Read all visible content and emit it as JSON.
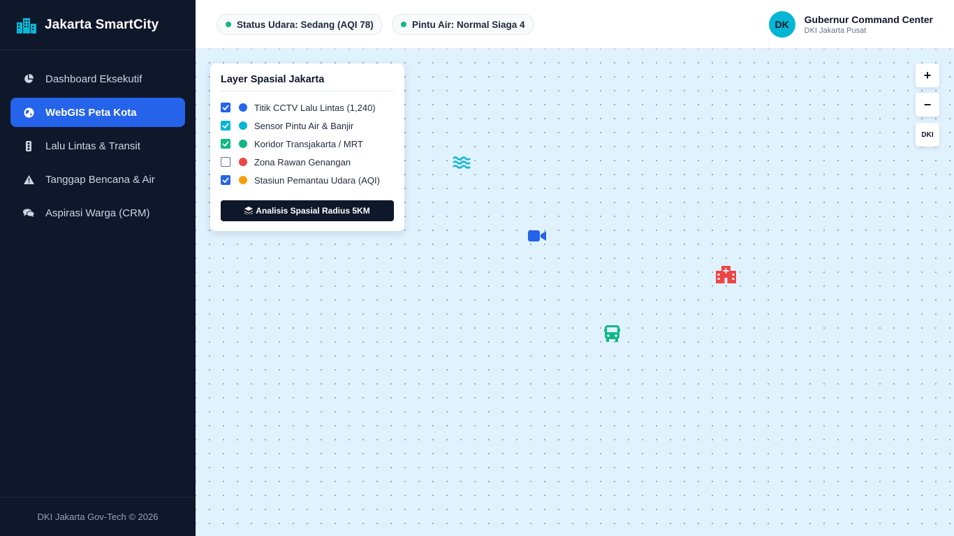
{
  "brand": {
    "title": "Jakarta SmartCity",
    "icon": "city-buildings-icon",
    "color": "#06b6d4"
  },
  "sidebar": {
    "items": [
      {
        "label": "Dashboard Eksekutif",
        "icon": "pie-chart-icon",
        "active": false
      },
      {
        "label": "WebGIS Peta Kota",
        "icon": "globe-icon",
        "active": true
      },
      {
        "label": "Lalu Lintas & Transit",
        "icon": "traffic-light-icon",
        "active": false
      },
      {
        "label": "Tanggap Bencana & Air",
        "icon": "warning-icon",
        "active": false
      },
      {
        "label": "Aspirasi Warga (CRM)",
        "icon": "comments-icon",
        "active": false
      }
    ],
    "footer": "DKI Jakarta Gov-Tech © 2026"
  },
  "topbar": {
    "air_status": "Status Udara: Sedang (AQI 78)",
    "floodgate_status": "Pintu Air: Normal Siaga 4",
    "status_color": "#10b981",
    "user": {
      "initials": "DK",
      "name": "Gubernur Command Center",
      "subtitle": "DKI Jakarta Pusat"
    }
  },
  "layer_panel": {
    "title": "Layer Spasial Jakarta",
    "layers": [
      {
        "label": "Titik CCTV Lalu Lintas (1,240)",
        "checked": true,
        "color": "#2563eb"
      },
      {
        "label": "Sensor Pintu Air & Banjir",
        "checked": true,
        "color": "#06b6d4"
      },
      {
        "label": "Koridor Transjakarta / MRT",
        "checked": true,
        "color": "#10b981"
      },
      {
        "label": "Zona Rawan Genangan",
        "checked": false,
        "color": "#ef4444"
      },
      {
        "label": "Stasiun Pemantau Udara (AQI)",
        "checked": true,
        "color": "#f59e0b"
      }
    ],
    "action_label": "Analisis Spasial Radius 5KM",
    "action_icon": "layers-icon"
  },
  "map_controls": {
    "zoom_in": "+",
    "zoom_out": "−",
    "reset": "DKI"
  },
  "markers": [
    {
      "name": "water-sensor-marker",
      "icon": "water-waves-icon",
      "color": "#06b6d4"
    },
    {
      "name": "cctv-marker",
      "icon": "video-camera-icon",
      "color": "#2563eb"
    },
    {
      "name": "hospital-marker",
      "icon": "hospital-icon",
      "color": "#ef4444"
    },
    {
      "name": "bus-marker",
      "icon": "bus-icon",
      "color": "#10b981"
    }
  ]
}
